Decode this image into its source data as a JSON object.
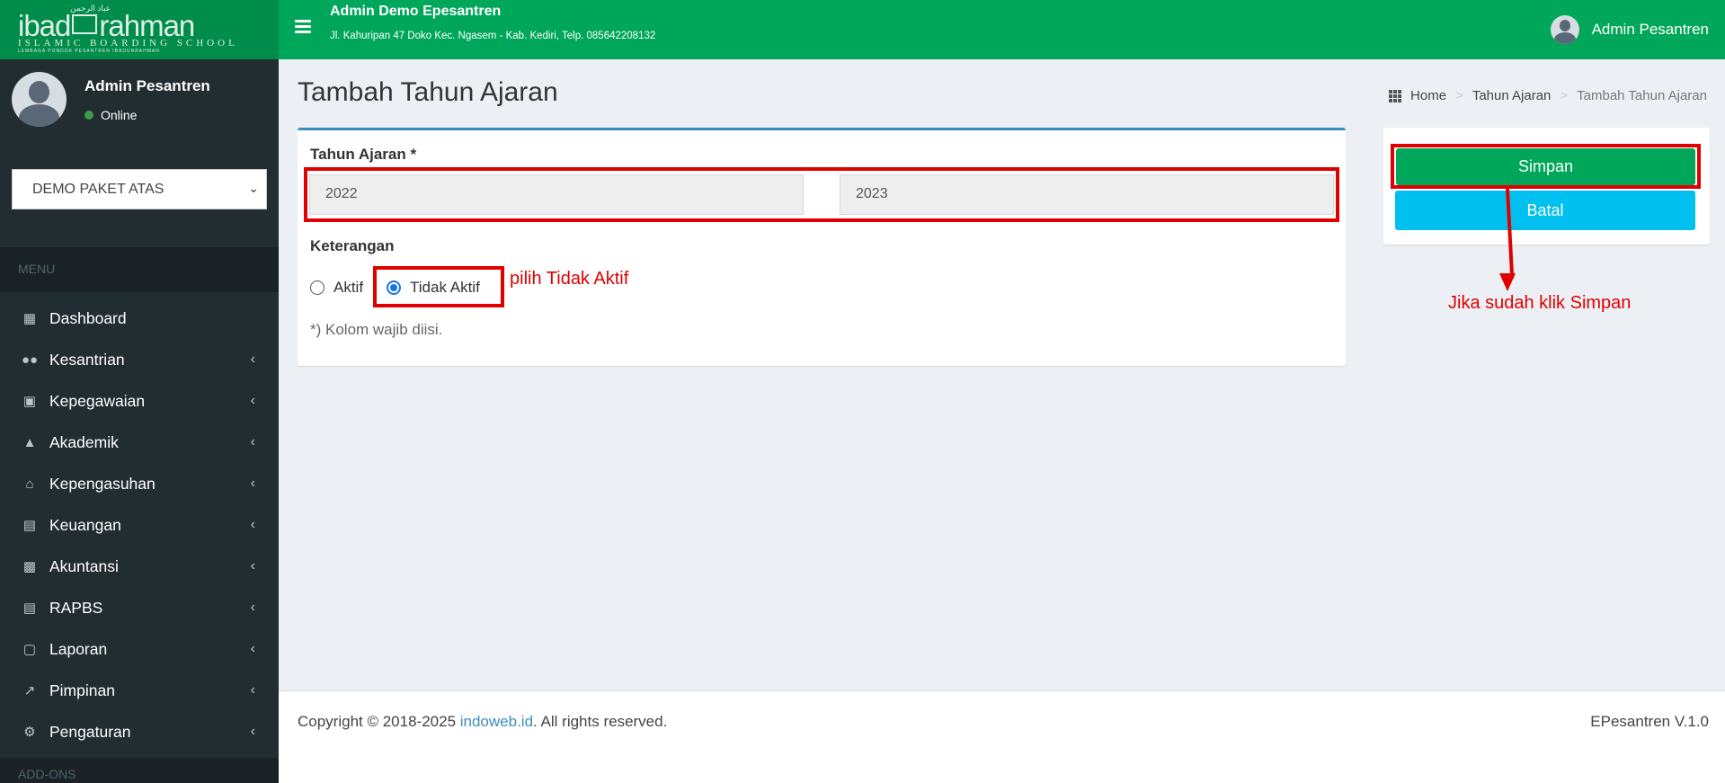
{
  "brand": {
    "logo_text_left": "ibad",
    "logo_text_right": "rahman",
    "logo_arabic": "عباد الرحمن",
    "logo_sub": "ISLAMIC BOARDING SCHOOL",
    "logo_sub2": "LEMBAGA PONDOK PESANTREN IBADURRAHMAN"
  },
  "header": {
    "app_title": "Admin Demo Epesantren",
    "address": "Jl. Kahuripan 47 Doko Kec. Ngasem - Kab. Kediri, Telp. 085642208132",
    "user_name": "Admin Pesantren"
  },
  "sidebar": {
    "user_name": "Admin Pesantren",
    "status": "Online",
    "package_select": "DEMO PAKET ATAS",
    "menu_header": "MENU",
    "addons_header": "ADD-ONS",
    "items": [
      {
        "label": "Dashboard",
        "icon": "grid-icon"
      },
      {
        "label": "Kesantrian",
        "icon": "users-icon"
      },
      {
        "label": "Kepegawaian",
        "icon": "briefcase-icon"
      },
      {
        "label": "Akademik",
        "icon": "graduation-cap-icon"
      },
      {
        "label": "Kepengasuhan",
        "icon": "home-icon"
      },
      {
        "label": "Keuangan",
        "icon": "money-icon"
      },
      {
        "label": "Akuntansi",
        "icon": "book-icon"
      },
      {
        "label": "RAPBS",
        "icon": "money-icon"
      },
      {
        "label": "Laporan",
        "icon": "file-icon"
      },
      {
        "label": "Pimpinan",
        "icon": "line-chart-icon"
      },
      {
        "label": "Pengaturan",
        "icon": "gear-icon"
      }
    ]
  },
  "page": {
    "title": "Tambah Tahun Ajaran",
    "breadcrumb": {
      "home": "Home",
      "level1": "Tahun Ajaran",
      "current": "Tambah Tahun Ajaran"
    }
  },
  "form": {
    "tahun_label": "Tahun Ajaran *",
    "tahun_start": "2022",
    "tahun_end": "2023",
    "keterangan_label": "Keterangan",
    "radio_aktif": "Aktif",
    "radio_tidak_aktif": "Tidak Aktif",
    "selected": "Tidak Aktif",
    "required_note": "*) Kolom wajib diisi."
  },
  "annotations": {
    "radio_hint": "pilih Tidak Aktif",
    "save_hint": "Jika sudah klik Simpan",
    "highlight_color": "#e00000"
  },
  "actions": {
    "save": "Simpan",
    "cancel": "Batal"
  },
  "footer": {
    "copyright_prefix": "Copyright © 2018-2025 ",
    "link": "indoweb.id",
    "copyright_suffix": ". All rights reserved.",
    "version": "EPesantren V.1.0"
  },
  "colors": {
    "header_green": "#00a65a",
    "sidebar_dark": "#222d32",
    "save_button": "#00a65a",
    "cancel_button": "#00c0ef",
    "box_accent": "#3c8dbc"
  }
}
